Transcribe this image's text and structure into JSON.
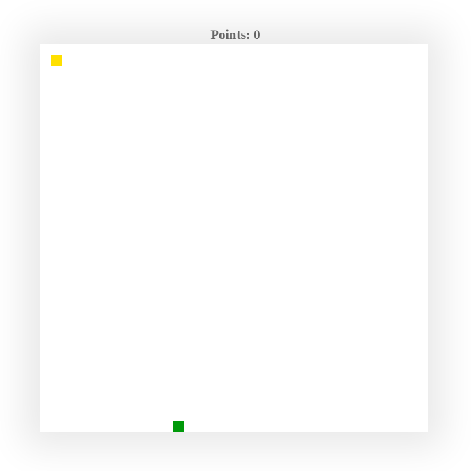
{
  "score": {
    "label": "Points: 0",
    "value": 0,
    "color": "#6b6b6b"
  },
  "board": {
    "background": "#ffffff"
  },
  "food": {
    "color": "#ffe000"
  },
  "snake": {
    "color": "#00990a",
    "length": 1
  }
}
